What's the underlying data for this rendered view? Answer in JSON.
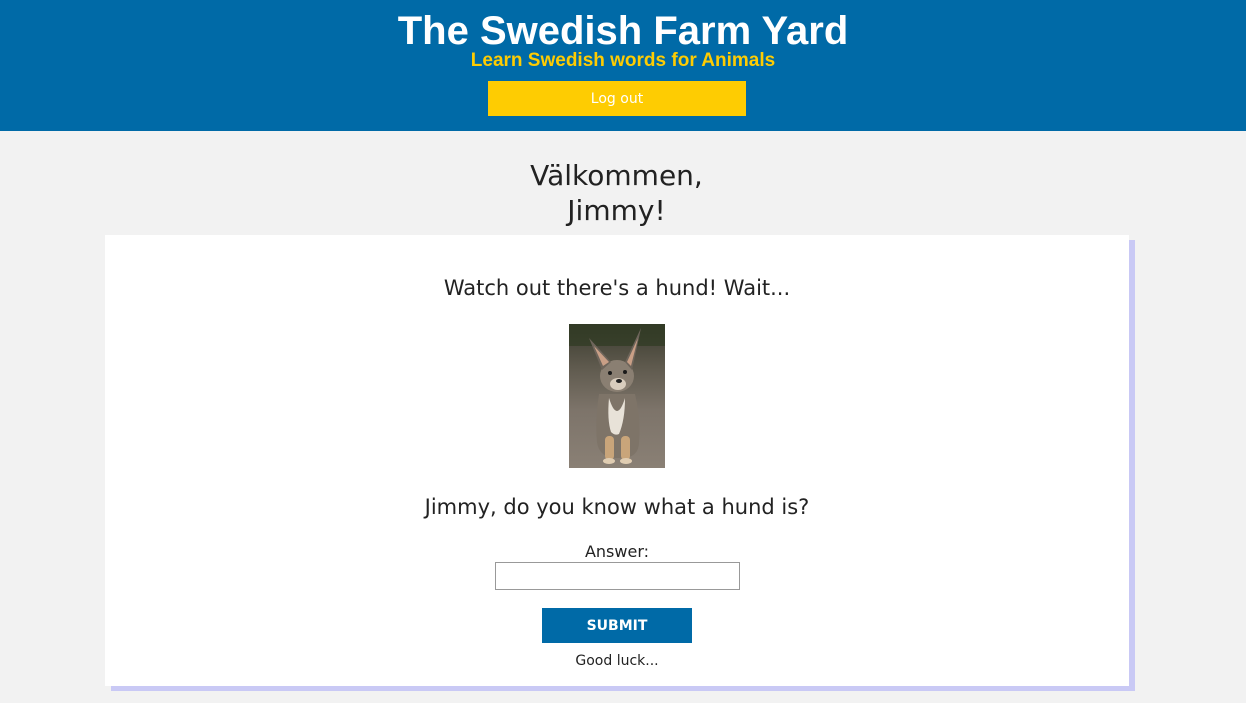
{
  "header": {
    "title": "The Swedish Farm Yard",
    "subtitle": "Learn Swedish words for Animals",
    "logout_label": "Log out"
  },
  "colors": {
    "brand_blue": "#006aa7",
    "brand_yellow": "#fecc02",
    "card_shadow": "#c9c9f5"
  },
  "welcome": {
    "line1": "Välkommen,",
    "line2": "Jimmy!"
  },
  "quiz": {
    "intro": "Watch out there's a hund! Wait...",
    "image": "dog-photo",
    "question": "Jimmy, do you know what a hund is?",
    "answer_label": "Answer:",
    "answer_value": "",
    "submit_label": "SUBMIT",
    "footer": "Good luck..."
  }
}
